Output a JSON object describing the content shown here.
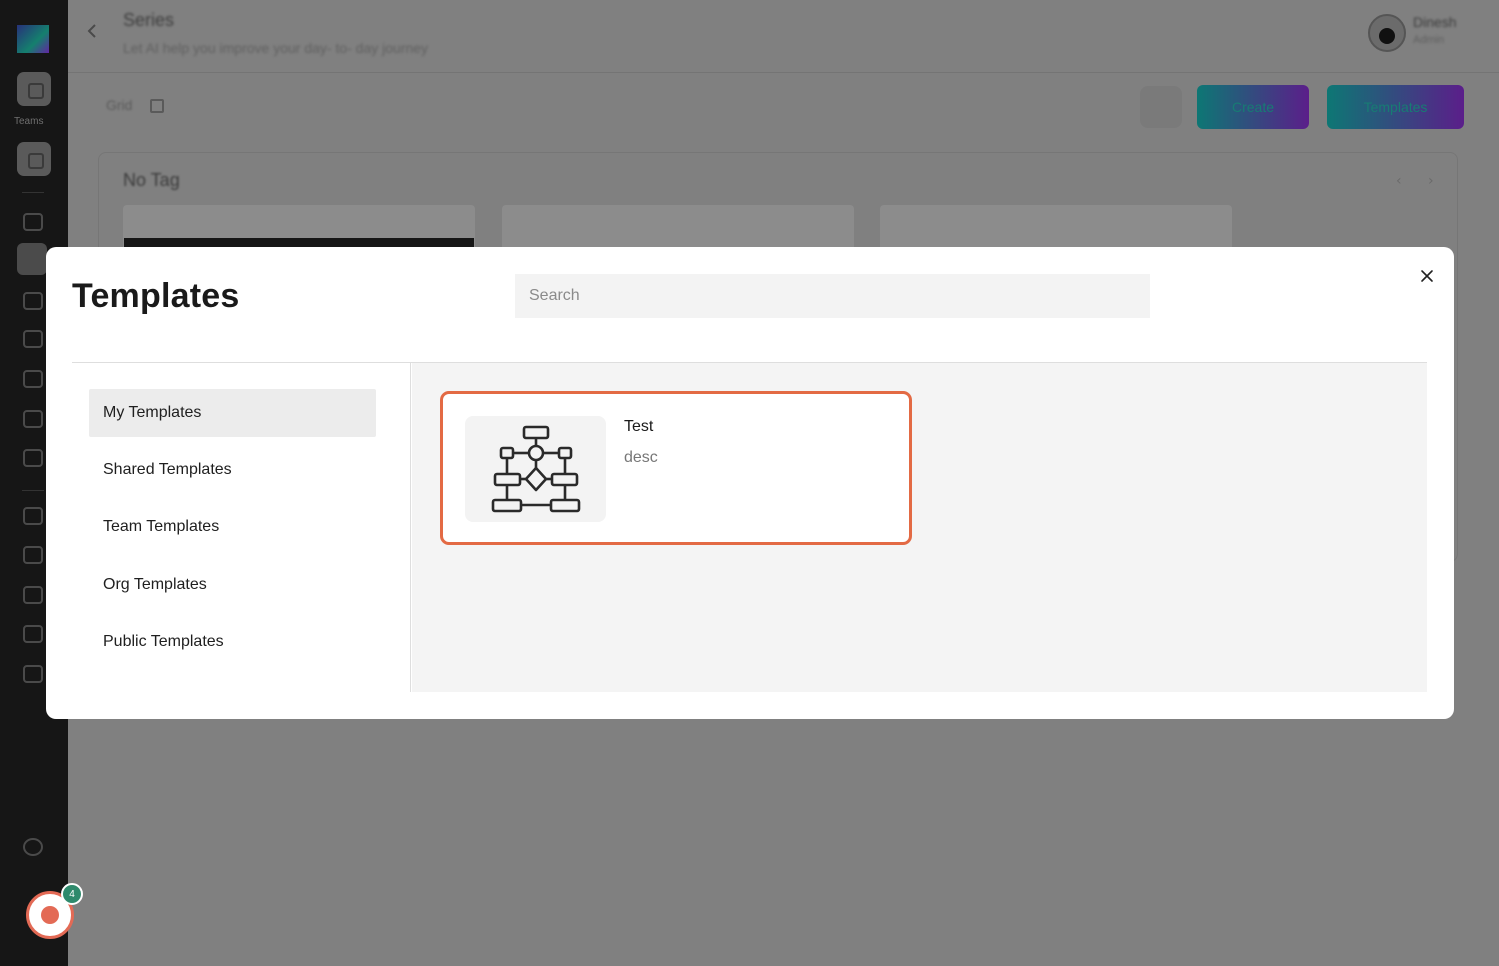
{
  "app": {
    "page_title": "Series",
    "page_subtitle": "Let AI help you improve your day- to- day journey",
    "user": {
      "name": "Dinesh",
      "role": "Admin"
    },
    "sidebar_caption": "Teams",
    "grid_label": "Grid",
    "create_label": "Create",
    "templates_label": "Templates",
    "section_title": "No Tag"
  },
  "recorder": {
    "badge_count": "4",
    "accent": "#e36a55",
    "badge_color": "#2f8a6c"
  },
  "modal": {
    "title": "Templates",
    "search": {
      "placeholder": "Search",
      "value": ""
    },
    "close_icon": "close-icon",
    "nav": [
      {
        "label": "My Templates",
        "active": true
      },
      {
        "label": "Shared Templates",
        "active": false
      },
      {
        "label": "Team Templates",
        "active": false
      },
      {
        "label": "Org Templates",
        "active": false
      },
      {
        "label": "Public Templates",
        "active": false
      }
    ],
    "templates": [
      {
        "name": "Test",
        "description": "desc",
        "icon": "flowchart-icon",
        "selected": true
      }
    ],
    "accent_color": "#e36a44"
  }
}
